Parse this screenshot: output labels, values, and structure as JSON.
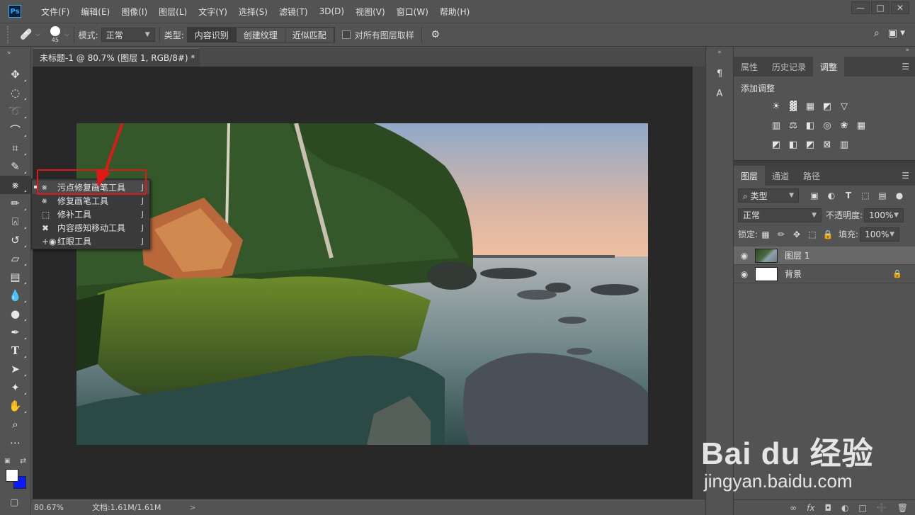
{
  "menubar": {
    "logo": "Ps",
    "items": [
      "文件(F)",
      "编辑(E)",
      "图像(I)",
      "图层(L)",
      "文字(Y)",
      "选择(S)",
      "滤镜(T)",
      "3D(D)",
      "视图(V)",
      "窗口(W)",
      "帮助(H)"
    ],
    "window_controls": [
      "—",
      "□",
      "✕"
    ]
  },
  "options": {
    "brush_size": "45",
    "mode_label": "模式:",
    "mode_value": "正常",
    "type_label": "类型:",
    "type_buttons": [
      "内容识别",
      "创建纹理",
      "近似匹配"
    ],
    "sample_all_label": "对所有图层取样"
  },
  "document": {
    "tab_title": "未标题-1 @ 80.7% (图层 1, RGB/8#) *",
    "tab_close": "×"
  },
  "flyout": {
    "items": [
      {
        "label": "污点修复画笔工具",
        "key": "J",
        "icon": "spot-healing-brush-icon"
      },
      {
        "label": "修复画笔工具",
        "key": "J",
        "icon": "healing-brush-icon"
      },
      {
        "label": "修补工具",
        "key": "J",
        "icon": "patch-icon"
      },
      {
        "label": "内容感知移动工具",
        "key": "J",
        "icon": "content-aware-move-icon"
      },
      {
        "label": "红眼工具",
        "key": "J",
        "icon": "red-eye-icon"
      }
    ]
  },
  "status": {
    "zoom": "80.67%",
    "doc_size": "文档:1.61M/1.61M",
    "arrow": ">"
  },
  "panels": {
    "top_tabs": [
      "属性",
      "历史记录",
      "调整"
    ],
    "adjustments_title": "添加调整",
    "layer_tabs": [
      "图层",
      "通道",
      "路径"
    ],
    "filter_type": "类型",
    "blend_mode": "正常",
    "opacity_label": "不透明度:",
    "opacity_value": "100%",
    "lock_label": "锁定:",
    "fill_label": "填充:",
    "fill_value": "100%",
    "layers": [
      {
        "name": "图层 1",
        "selected": true
      },
      {
        "name": "背景",
        "selected": false,
        "locked": true
      }
    ]
  },
  "watermark": {
    "brand": "Bai du 经验",
    "url": "jingyan.baidu.com"
  },
  "colors": {
    "foreground": "#ffffff",
    "background": "#0a1aff",
    "highlight": "#e01818"
  }
}
